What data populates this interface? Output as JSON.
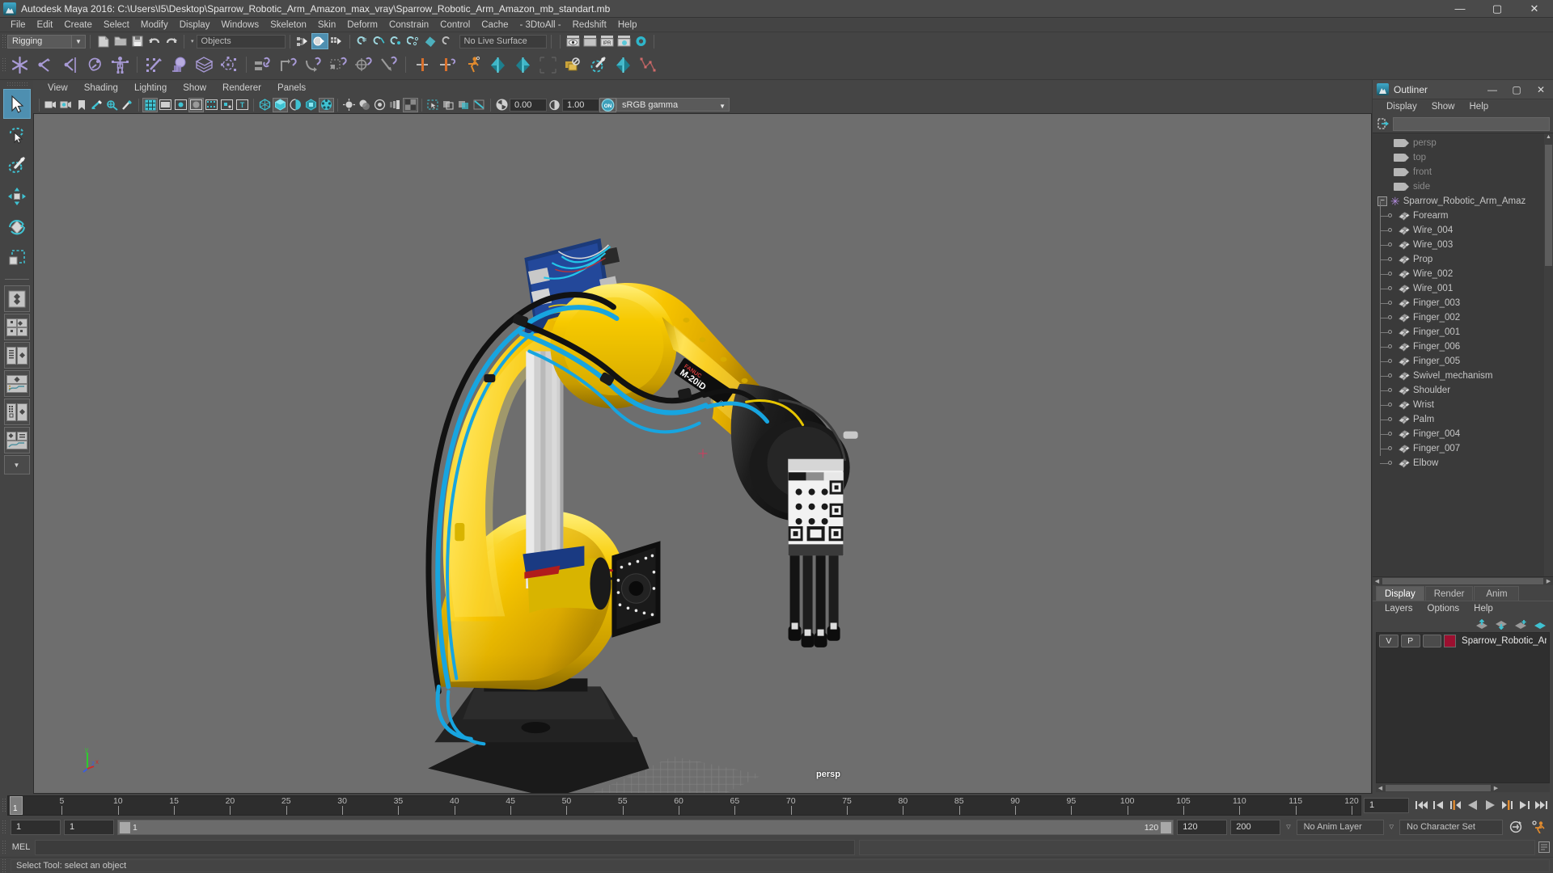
{
  "window": {
    "title": "Autodesk Maya 2016: C:\\Users\\I5\\Desktop\\Sparrow_Robotic_Arm_Amazon_max_vray\\Sparrow_Robotic_Arm_Amazon_mb_standart.mb",
    "app_icon": "maya-icon",
    "minimize": "—",
    "maximize": "▢",
    "close": "✕"
  },
  "menubar": {
    "items": [
      {
        "label": "File"
      },
      {
        "label": "Edit"
      },
      {
        "label": "Create"
      },
      {
        "label": "Select"
      },
      {
        "label": "Modify"
      },
      {
        "label": "Display"
      },
      {
        "label": "Windows"
      },
      {
        "label": "Skeleton"
      },
      {
        "label": "Skin"
      },
      {
        "label": "Deform"
      },
      {
        "label": "Constrain"
      },
      {
        "label": "Control"
      },
      {
        "label": "Cache"
      },
      {
        "label": "- 3DtoAll -"
      },
      {
        "label": "Redshift"
      },
      {
        "label": "Help"
      }
    ]
  },
  "statusline": {
    "menuset": "Rigging",
    "selection_mask": "Objects",
    "live_surface": "No Live Surface",
    "icons": [
      "new-scene-icon",
      "open-scene-icon",
      "save-scene-icon",
      "undo-icon",
      "redo-icon",
      "select-hierarchy-icon",
      "select-object-icon",
      "select-component-icon",
      "snap-grid-icon",
      "snap-curve-icon",
      "snap-point-icon",
      "snap-projected-center-icon",
      "snap-view-plane-icon",
      "make-live-icon",
      "render-view-icon",
      "render-current-frame-icon",
      "ipr-render-icon",
      "render-settings-icon",
      "hypershade-icon"
    ],
    "ipr_label": "IPR"
  },
  "shelf": {
    "icons": [
      "create-joint-icon",
      "ik-handle-icon",
      "ik-spline-handle-icon",
      "insert-joint-icon",
      "quick-rig-icon",
      "bind-skin-icon",
      "interactive-bind-icon",
      "lattice-deformer-icon",
      "cluster-deformer-icon",
      "parent-constraint-icon",
      "point-constraint-icon",
      "orient-constraint-icon",
      "scale-constraint-icon",
      "aim-constraint-icon",
      "pole-vector-constraint-icon",
      "mirror-joint-icon",
      "mirror-skin-weights-icon",
      "humanik-icon",
      "pose-deformer-icon",
      "pose-deformer-2-icon",
      "copy-skin-weights-icon",
      "paint-skin-weights-icon",
      "blend-shape-icon",
      "curve-editor-icon"
    ]
  },
  "toolbox": {
    "tools": [
      {
        "name": "select-tool",
        "selected": true
      },
      {
        "name": "lasso-select-tool",
        "selected": false
      },
      {
        "name": "paint-select-tool",
        "selected": false
      },
      {
        "name": "move-tool",
        "selected": false
      },
      {
        "name": "rotate-tool",
        "selected": false
      },
      {
        "name": "scale-tool",
        "selected": false
      }
    ],
    "layouts": [
      "single-perspective-layout",
      "four-view-layout",
      "outliner-persp-layout",
      "persp-graph-layout",
      "hypershade-persp-layout",
      "persp-graph-outliner-layout"
    ]
  },
  "viewport": {
    "menus": [
      {
        "label": "View"
      },
      {
        "label": "Shading"
      },
      {
        "label": "Lighting"
      },
      {
        "label": "Show"
      },
      {
        "label": "Renderer"
      },
      {
        "label": "Panels"
      }
    ],
    "toolbar_icons": [
      "select-camera-icon",
      "camera-attributes-icon",
      "bookmark-icon",
      "image-plane-icon",
      "two-d-pan-zoom-icon",
      "grease-pencil-icon",
      "grid-toggle-icon",
      "film-gate-icon",
      "resolution-gate-icon",
      "gate-mask-icon",
      "film-origin-icon",
      "xray-joints-icon",
      "texture-borders-icon",
      "wireframe-shading-icon",
      "smooth-shade-all-icon",
      "smooth-shade-selected-icon",
      "flat-shade-icon",
      "hardware-texturing-icon",
      "use-default-lighting-icon",
      "shadows-icon",
      "screen-space-ao-icon",
      "motion-blur-icon",
      "multisample-icon",
      "isolate-select-icon",
      "xray-mode-icon",
      "xray-active-icon",
      "exposure-icon",
      "gamma-icon",
      "color-management-icon"
    ],
    "exposure_value": "0.00",
    "gamma_value": "1.00",
    "color_management_toggle": "ON",
    "view_transform": "sRGB gamma",
    "camera_label": "persp",
    "axis_labels": {
      "x": "x",
      "y": "y",
      "z": "z"
    },
    "axis_colors": {
      "x": "#cc2b2b",
      "y": "#2ecc2e",
      "z": "#3b5ce0"
    },
    "background_color": "#6e6e6e"
  },
  "outliner": {
    "title": "Outliner",
    "menus": [
      {
        "label": "Display"
      },
      {
        "label": "Show"
      },
      {
        "label": "Help"
      }
    ],
    "search_value": "",
    "search_placeholder": "",
    "nodes": [
      {
        "label": "persp",
        "type": "camera",
        "dim": true,
        "depth": 0
      },
      {
        "label": "top",
        "type": "camera",
        "dim": true,
        "depth": 0
      },
      {
        "label": "front",
        "type": "camera",
        "dim": true,
        "depth": 0
      },
      {
        "label": "side",
        "type": "camera",
        "dim": true,
        "depth": 0
      },
      {
        "label": "Sparrow_Robotic_Arm_Amaz",
        "type": "group",
        "dim": false,
        "depth": 0,
        "expanded": true
      },
      {
        "label": "Forearm",
        "type": "mesh",
        "dim": false,
        "depth": 1
      },
      {
        "label": "Wire_004",
        "type": "mesh",
        "dim": false,
        "depth": 1
      },
      {
        "label": "Wire_003",
        "type": "mesh",
        "dim": false,
        "depth": 1
      },
      {
        "label": "Prop",
        "type": "mesh",
        "dim": false,
        "depth": 1
      },
      {
        "label": "Wire_002",
        "type": "mesh",
        "dim": false,
        "depth": 1
      },
      {
        "label": "Wire_001",
        "type": "mesh",
        "dim": false,
        "depth": 1
      },
      {
        "label": "Finger_003",
        "type": "mesh",
        "dim": false,
        "depth": 1
      },
      {
        "label": "Finger_002",
        "type": "mesh",
        "dim": false,
        "depth": 1
      },
      {
        "label": "Finger_001",
        "type": "mesh",
        "dim": false,
        "depth": 1
      },
      {
        "label": "Finger_006",
        "type": "mesh",
        "dim": false,
        "depth": 1
      },
      {
        "label": "Finger_005",
        "type": "mesh",
        "dim": false,
        "depth": 1
      },
      {
        "label": "Swivel_mechanism",
        "type": "mesh",
        "dim": false,
        "depth": 1
      },
      {
        "label": "Shoulder",
        "type": "mesh",
        "dim": false,
        "depth": 1
      },
      {
        "label": "Wrist",
        "type": "mesh",
        "dim": false,
        "depth": 1
      },
      {
        "label": "Palm",
        "type": "mesh",
        "dim": false,
        "depth": 1
      },
      {
        "label": "Finger_004",
        "type": "mesh",
        "dim": false,
        "depth": 1
      },
      {
        "label": "Finger_007",
        "type": "mesh",
        "dim": false,
        "depth": 1
      },
      {
        "label": "Elbow",
        "type": "mesh",
        "dim": false,
        "depth": 1,
        "last": true
      }
    ]
  },
  "layer_editor": {
    "tabs": [
      {
        "label": "Display",
        "active": true
      },
      {
        "label": "Render",
        "active": false
      },
      {
        "label": "Anim",
        "active": false
      }
    ],
    "menus": [
      {
        "label": "Layers"
      },
      {
        "label": "Options"
      },
      {
        "label": "Help"
      }
    ],
    "toolbar_icons": [
      "move-layer-up-icon",
      "move-layer-down-icon",
      "new-layer-icon",
      "new-layer-from-selected-icon"
    ],
    "layers": [
      {
        "visibility": "V",
        "playback": "P",
        "shading": "",
        "color": "#9c1030",
        "name": "Sparrow_Robotic_Arm"
      }
    ]
  },
  "timeslider": {
    "current_frame": "1",
    "ticks": [
      5,
      10,
      15,
      20,
      25,
      30,
      35,
      40,
      45,
      50,
      55,
      60,
      65,
      70,
      75,
      80,
      85,
      90,
      95,
      100,
      105,
      110,
      115,
      120
    ],
    "start": 1,
    "end": 120,
    "playback_buttons": [
      "go-to-start-icon",
      "step-back-keyframe-icon",
      "step-back-frame-icon",
      "play-backwards-icon",
      "play-forwards-icon",
      "step-forward-frame-icon",
      "step-forward-keyframe-icon",
      "go-to-end-icon"
    ]
  },
  "rangebar": {
    "anim_start": "1",
    "range_start": "1",
    "range_slider_left_label": "1",
    "range_slider_right_label": "120",
    "range_end": "120",
    "anim_end": "200",
    "anim_layer": "No Anim Layer",
    "character_set": "No Character Set",
    "icons": [
      "auto-keyframe-icon",
      "animation-preferences-icon"
    ]
  },
  "command_line": {
    "language_label": "MEL",
    "input_value": "",
    "output_value": "",
    "script_editor_icon": "script-editor-icon"
  },
  "help_line": {
    "message": "Select Tool: select an object"
  }
}
